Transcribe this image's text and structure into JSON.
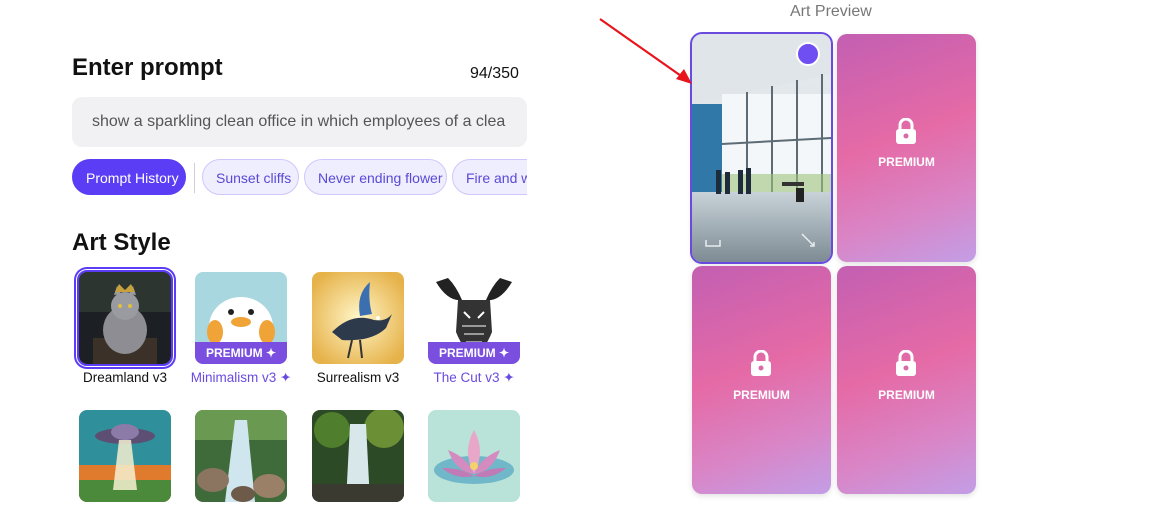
{
  "prompt_panel": {
    "title": "Enter prompt",
    "char_count": "94/350",
    "prompt_value": "show a sparkling clean office in which employees of a clea",
    "chips": [
      {
        "label": "Prompt History",
        "style": "primary"
      },
      {
        "label": "Sunset cliffs",
        "style": "soft"
      },
      {
        "label": "Never ending flower",
        "style": "soft"
      },
      {
        "label": "Fire and wa",
        "style": "soft"
      }
    ]
  },
  "art_style": {
    "title": "Art Style",
    "premium_tag": "PREMIUM ✦",
    "styles": [
      {
        "label": "Dreamland v3",
        "premium": false,
        "selected": true,
        "icon": "dreamland-cat-thumbnail"
      },
      {
        "label": "Minimalism v3 ✦",
        "premium": true,
        "selected": false,
        "icon": "minimalism-duck-thumbnail"
      },
      {
        "label": "Surrealism v3",
        "premium": false,
        "selected": false,
        "icon": "surrealism-bird-thumbnail"
      },
      {
        "label": "The Cut v3 ✦",
        "premium": true,
        "selected": false,
        "icon": "the-cut-moose-thumbnail"
      },
      {
        "label": "",
        "premium": false,
        "selected": false,
        "icon": "ufo-thumbnail"
      },
      {
        "label": "",
        "premium": false,
        "selected": false,
        "icon": "waterfall-rocks-thumbnail"
      },
      {
        "label": "",
        "premium": false,
        "selected": false,
        "icon": "waterfall-forest-thumbnail"
      },
      {
        "label": "",
        "premium": false,
        "selected": false,
        "icon": "lotus-flower-thumbnail"
      }
    ]
  },
  "preview": {
    "title": "Art Preview",
    "locked_label": "PREMIUM",
    "tiles": [
      {
        "state": "generated",
        "selected": true,
        "icon": "office-image"
      },
      {
        "state": "locked",
        "icon": "lock-icon"
      },
      {
        "state": "locked",
        "icon": "lock-icon"
      },
      {
        "state": "locked",
        "icon": "lock-icon"
      }
    ]
  },
  "colors": {
    "accent": "#5b3df5",
    "premium_gradient_start": "#c35fb2",
    "premium_gradient_end": "#c39ee6",
    "annotation_arrow": "#e8141b"
  }
}
